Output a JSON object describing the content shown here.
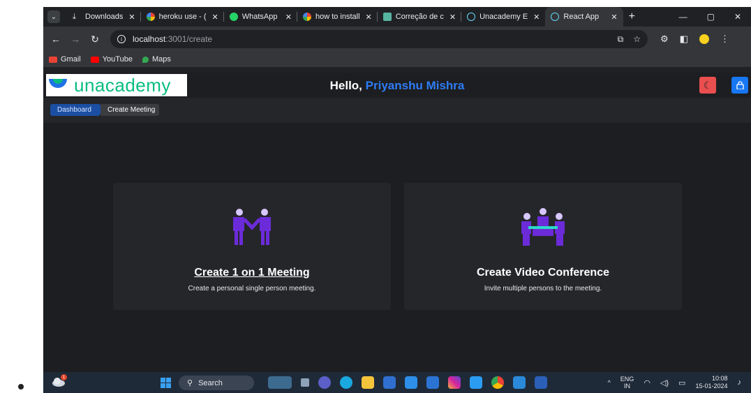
{
  "browser": {
    "tabs": [
      {
        "label": "Downloads",
        "fav_color": "#e8eaed",
        "icon": "download-icon",
        "active": false
      },
      {
        "label": "heroku use - (",
        "fav_color": "#ffffff",
        "icon": "google-icon",
        "active": false
      },
      {
        "label": "WhatsApp",
        "fav_color": "#25d366",
        "icon": "whatsapp-icon",
        "active": false
      },
      {
        "label": "how to install",
        "fav_color": "#ffffff",
        "icon": "google-icon",
        "active": false
      },
      {
        "label": "Correção de c",
        "fav_color": "#56b3a0",
        "icon": "page-icon",
        "active": false
      },
      {
        "label": "Unacademy E",
        "fav_color": "#61dafb",
        "icon": "react-icon",
        "active": false
      },
      {
        "label": "React App",
        "fav_color": "#61dafb",
        "icon": "react-icon",
        "active": true
      }
    ],
    "new_tab": "+",
    "url_host": "localhost",
    "url_path": ":3001/create",
    "bookmarks": [
      {
        "label": "Gmail",
        "color": "#ea4335",
        "icon": "gmail-icon"
      },
      {
        "label": "YouTube",
        "color": "#ff0000",
        "icon": "youtube-icon"
      },
      {
        "label": "Maps",
        "color": "#34a853",
        "icon": "maps-icon"
      }
    ]
  },
  "app": {
    "logo_text": "unacademy",
    "greeting": "Hello,",
    "user_name": "Priyanshu Mishra",
    "breadcrumbs": [
      "Dashboard",
      "Create Meeting"
    ],
    "cards": [
      {
        "title": "Create 1 on 1 Meeting",
        "description": "Create a personal single person meeting."
      },
      {
        "title": "Create Video Conference",
        "description": "Invite multiple persons to the meeting."
      }
    ],
    "colors": {
      "accent": "#2e7cf6",
      "logo_green": "#08bd80",
      "figure_purple": "#6c2bd9",
      "table_teal": "#2bd9c8"
    }
  },
  "taskbar": {
    "search_placeholder": "Search",
    "weather_badge": "1",
    "lang_line1": "ENG",
    "lang_line2": "IN",
    "time": "10:08",
    "date": "15-01-2024"
  }
}
